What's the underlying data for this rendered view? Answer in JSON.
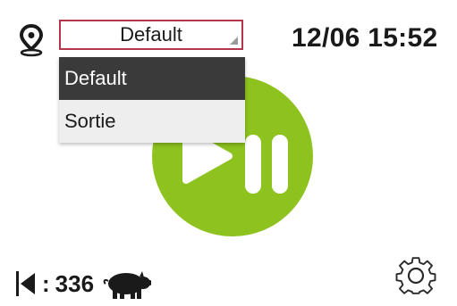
{
  "header": {
    "location_icon": "location-pin-icon",
    "selected_zone": "Default",
    "datetime": "12/06 15:52"
  },
  "menu": {
    "items": [
      {
        "label": "Default",
        "selected": true
      },
      {
        "label": "Sortie",
        "selected": false
      }
    ]
  },
  "controls": {
    "play_pause_icon": "play-pause-icon",
    "accent_color": "#8dc21f"
  },
  "footer": {
    "counter_prefix": ":",
    "count": "336",
    "counter_icon": "skip-back-icon",
    "animal_icon": "pig-icon",
    "settings_icon": "gear-icon"
  }
}
